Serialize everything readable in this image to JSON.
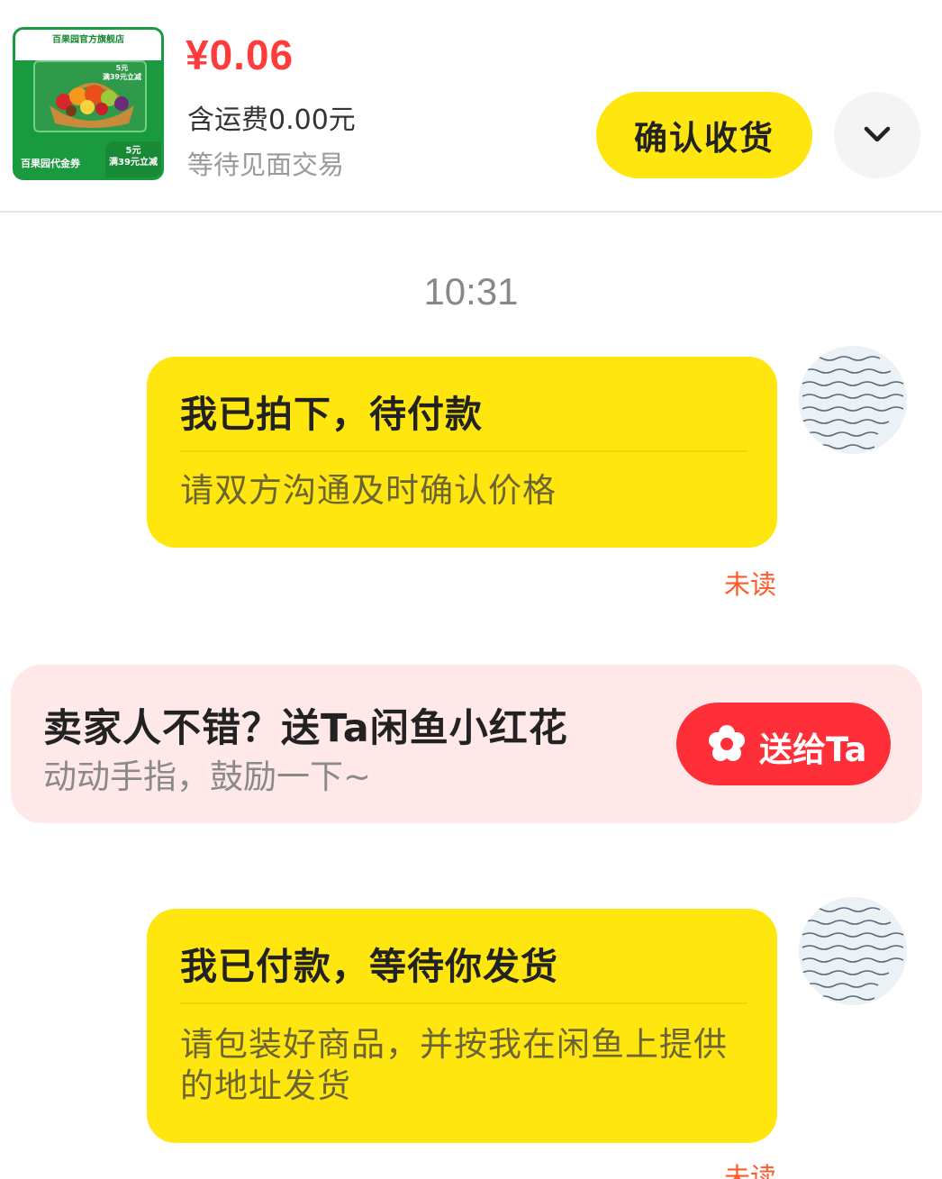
{
  "order": {
    "product_thumb": {
      "top_label": "百果园官方旗舰店",
      "card_deal": [
        "5元",
        "满39元立减"
      ],
      "bottom_label": "百果园代金券",
      "bottom_deal": [
        "5元",
        "满39元立减"
      ]
    },
    "price": "¥0.06",
    "shipping": "含运费0.00元",
    "status": "等待见面交易",
    "confirm_label": "确认收货",
    "more_icon": "chevron-down-icon"
  },
  "chat": {
    "timestamp": "10:31",
    "messages": [
      {
        "title": "我已拍下，待付款",
        "body": "请双方沟通及时确认价格",
        "read_status": "未读"
      },
      {
        "title": "我已付款，等待你发货",
        "body": "请包装好商品，并按我在闲鱼上提供的地址发货",
        "read_status": "未读"
      }
    ]
  },
  "promo": {
    "title": "卖家人不错？送Ta闲鱼小红花",
    "subtitle": "动动手指，鼓励一下~",
    "button_label": "送给Ta",
    "button_icon": "flower-icon"
  },
  "colors": {
    "accent_yellow": "#ffe60f",
    "price_red": "#ff3b3b",
    "unread_orange": "#ff5a2a",
    "gift_red": "#ff2f39",
    "promo_bg": "#ffe9e8"
  }
}
